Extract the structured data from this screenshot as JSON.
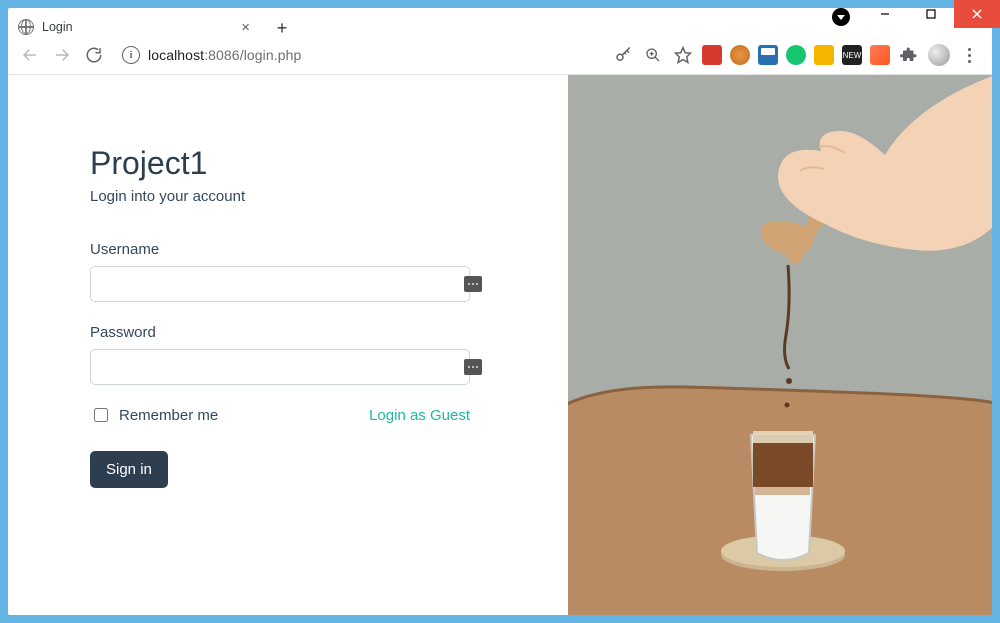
{
  "window": {
    "controls": {
      "min": "—",
      "max": "□",
      "close": "✕"
    }
  },
  "browser": {
    "tab_title": "Login",
    "new_tab": "+",
    "url": {
      "host": "localhost",
      "port": ":8086",
      "path": "/login.php"
    }
  },
  "login": {
    "brand": "Project1",
    "subtitle": "Login into your account",
    "username_label": "Username",
    "username_value": "",
    "password_label": "Password",
    "password_value": "",
    "remember_label": "Remember me",
    "guest_link": "Login as Guest",
    "signin": "Sign in"
  }
}
